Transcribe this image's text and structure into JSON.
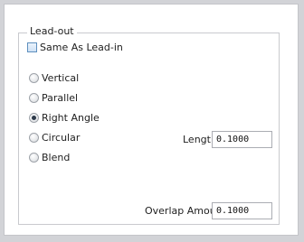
{
  "group": {
    "title": "Lead-out",
    "same_as_leadin": {
      "label": "Same As Lead-in",
      "checked": false
    }
  },
  "options": [
    {
      "label": "Vertical",
      "selected": false
    },
    {
      "label": "Parallel",
      "selected": false
    },
    {
      "label": "Right Angle",
      "selected": true
    },
    {
      "label": "Circular",
      "selected": false
    },
    {
      "label": "Blend",
      "selected": false
    }
  ],
  "length": {
    "label": "Length",
    "value": "0.1000"
  },
  "overlap": {
    "label": "Overlap Amount",
    "value": "0.1000"
  }
}
